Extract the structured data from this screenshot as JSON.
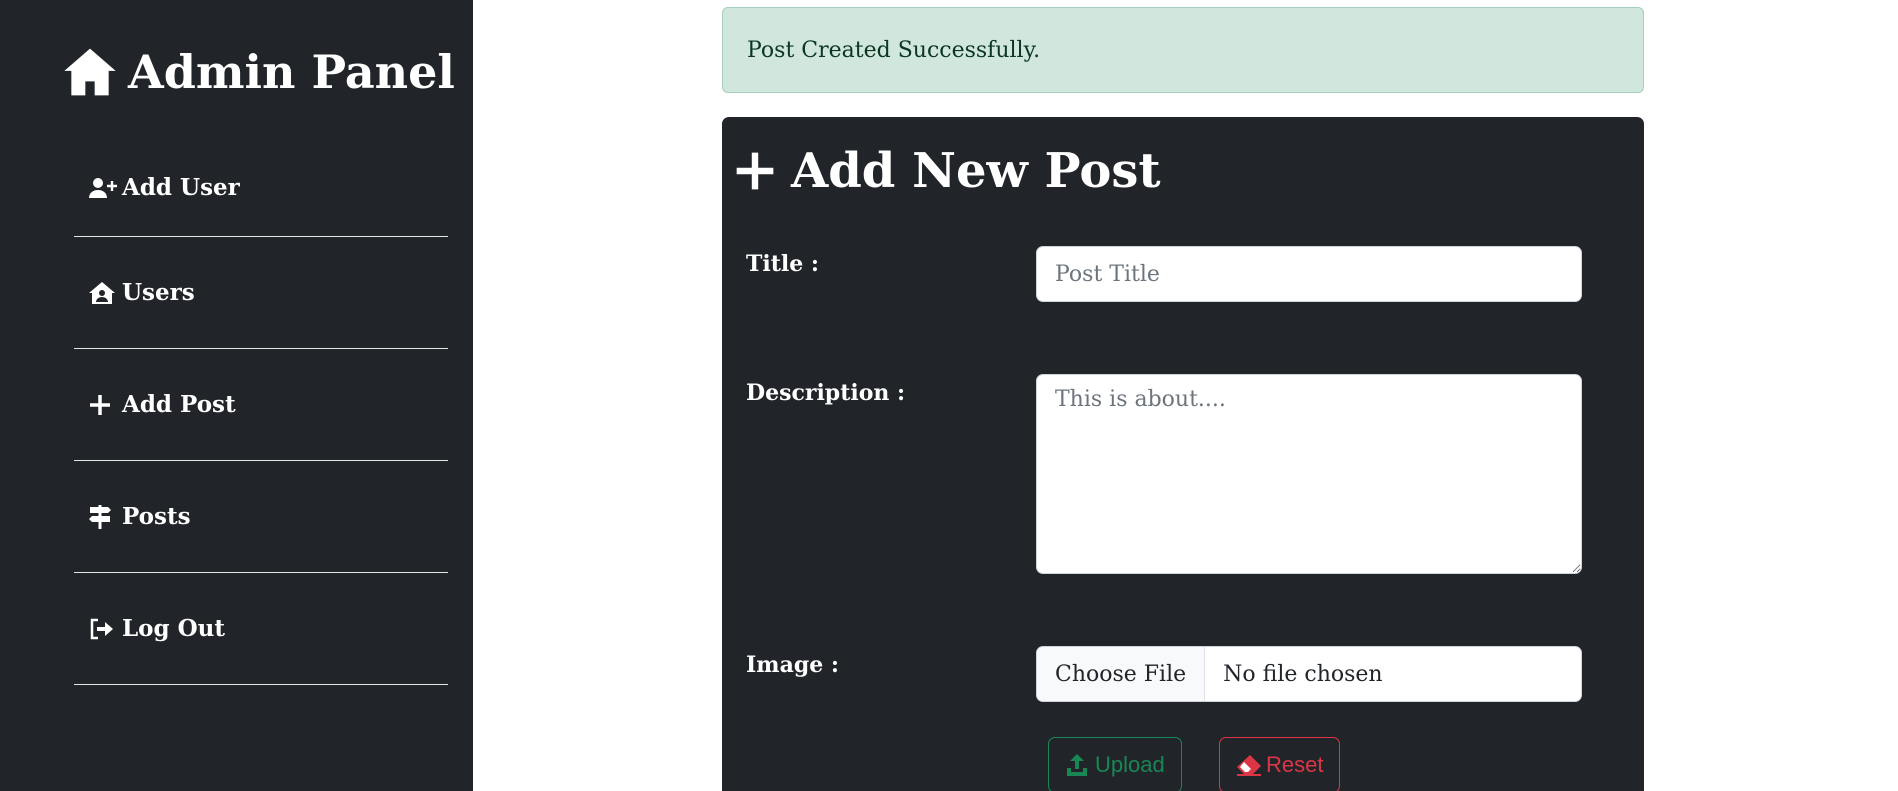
{
  "sidebar": {
    "brand": "Admin Panel",
    "brand_icon": "home-icon",
    "items": [
      {
        "label": "Add User",
        "icon": "user-plus-icon"
      },
      {
        "label": "Users",
        "icon": "house-user-icon"
      },
      {
        "label": "Add Post",
        "icon": "plus-icon"
      },
      {
        "label": "Posts",
        "icon": "signs-post-icon"
      },
      {
        "label": "Log Out",
        "icon": "logout-icon"
      }
    ]
  },
  "alert": {
    "message": "Post Created Successfully."
  },
  "form": {
    "title": "Add New Post",
    "title_label": "Title :",
    "title_placeholder": "Post Title",
    "description_label": "Description :",
    "description_placeholder": "This is about....",
    "image_label": "Image :",
    "choose_file": "Choose File",
    "no_file": "No file chosen",
    "upload": "Upload",
    "reset": "Reset"
  },
  "colors": {
    "sidebar_bg": "#212529",
    "alert_bg": "#d1e7dd",
    "alert_text": "#0a3622",
    "success": "#198754",
    "danger": "#dc3545"
  }
}
